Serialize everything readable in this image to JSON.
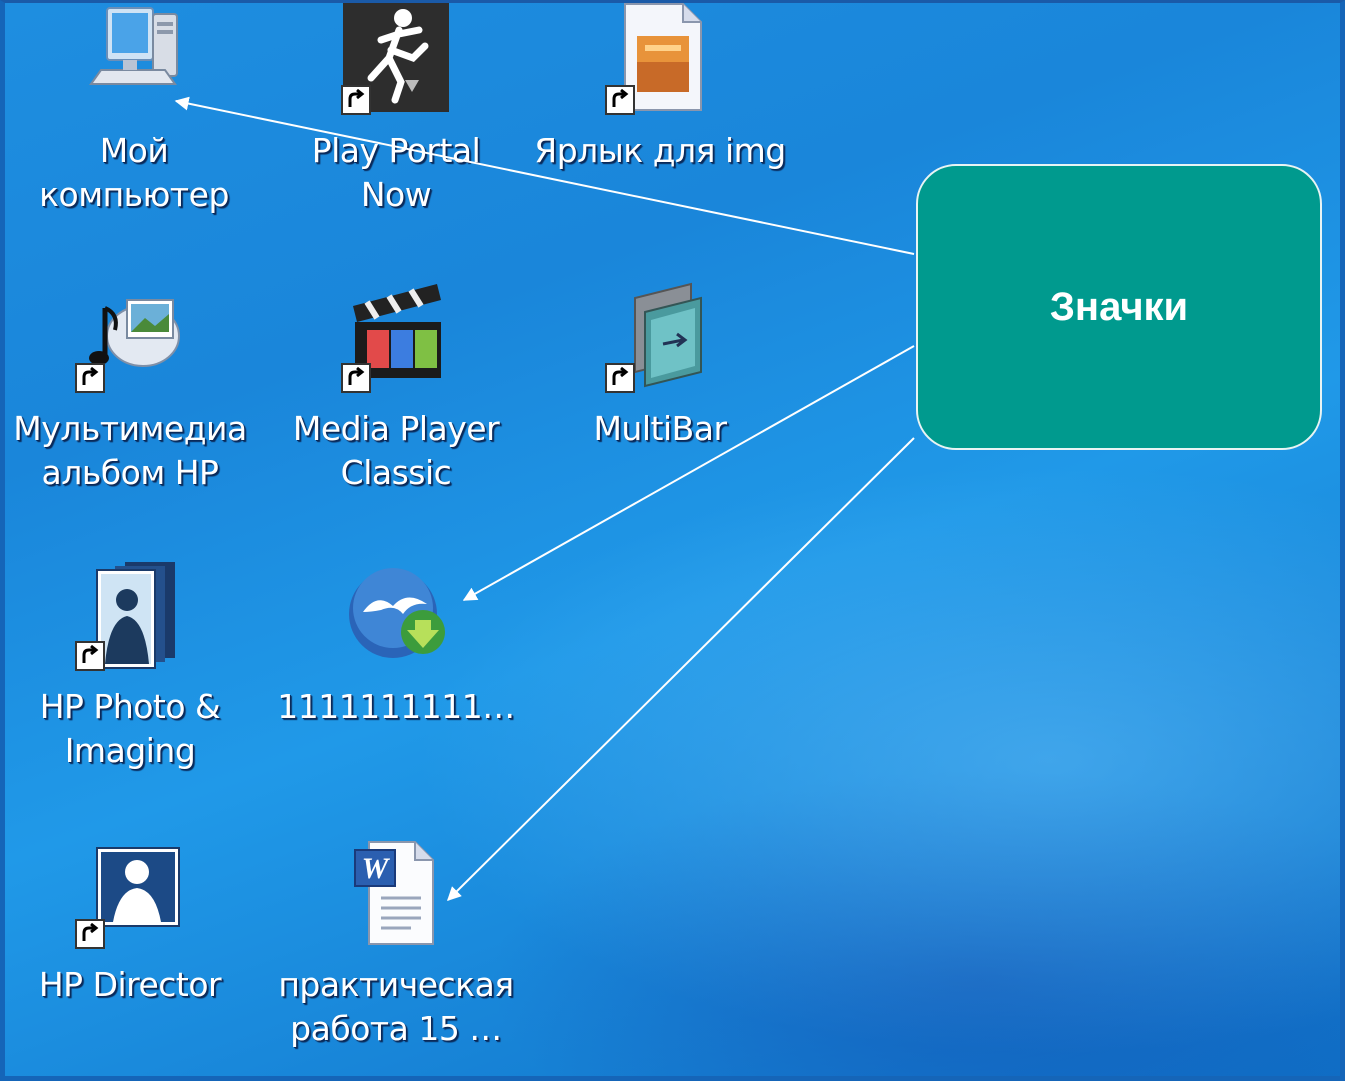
{
  "desktop": {
    "icons": [
      {
        "id": "my-computer",
        "label": "Мой\nкомпьютер",
        "icon": "computer-icon",
        "shortcut": false
      },
      {
        "id": "play-portal",
        "label": "Play Portal\nNow",
        "icon": "play-portal-icon",
        "shortcut": true
      },
      {
        "id": "img-shortcut",
        "label": "Ярлык для img",
        "icon": "image-file-icon",
        "shortcut": true
      },
      {
        "id": "hp-multimedia",
        "label": "Мультимедиа\nальбом HP",
        "icon": "multimedia-album-icon",
        "shortcut": true
      },
      {
        "id": "media-player-classic",
        "label": "Media Player\nClassic",
        "icon": "clapperboard-icon",
        "shortcut": true
      },
      {
        "id": "multibar",
        "label": "MultiBar",
        "icon": "multibar-icon",
        "shortcut": true
      },
      {
        "id": "hp-photo",
        "label": "HP Photo &\nImaging",
        "icon": "hp-photo-icon",
        "shortcut": true
      },
      {
        "id": "openoffice-file",
        "label": "1111111111…",
        "icon": "openoffice-download-icon",
        "shortcut": false
      },
      {
        "id": "hp-director",
        "label": "HP Director",
        "icon": "hp-director-icon",
        "shortcut": true
      },
      {
        "id": "practical-work",
        "label": "практическая\nработа 15 …",
        "icon": "word-document-icon",
        "shortcut": false
      }
    ]
  },
  "callout": {
    "text": "Значки"
  },
  "colors": {
    "callout_bg": "#009a8e",
    "desktop_bg": "#1a86da"
  }
}
